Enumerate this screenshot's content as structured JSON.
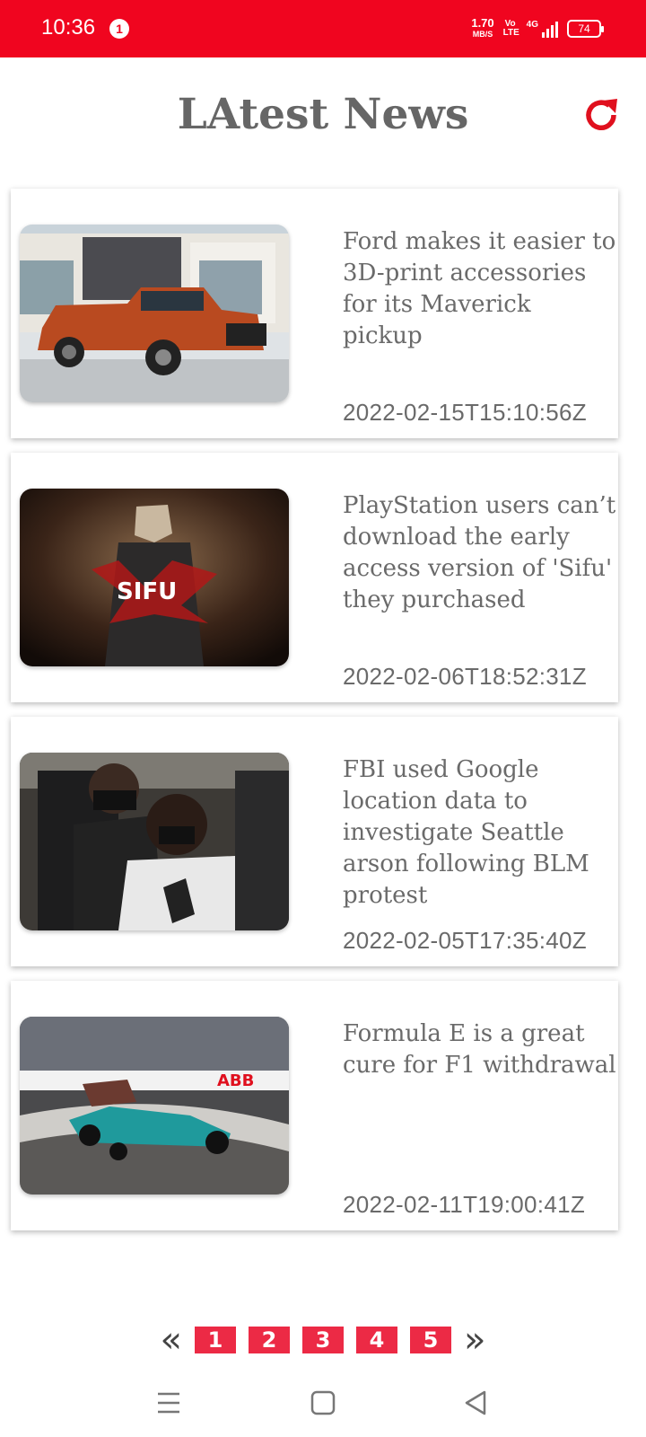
{
  "status_bar": {
    "time": "10:36",
    "notification_count": "1",
    "speed_value": "1.70",
    "speed_unit": "MB/S",
    "volte": "Vo LTE",
    "network": "4G",
    "battery": "74"
  },
  "header": {
    "title": "LAtest News",
    "refresh_icon": "refresh-icon"
  },
  "articles": [
    {
      "headline": "Ford makes it easier to 3D-print accessories for its Maverick pickup",
      "timestamp": "2022-02-15T15:10:56Z",
      "image": "orange pickup truck"
    },
    {
      "headline": "PlayStation users can’t download the early access version of 'Sifu' they purchased",
      "timestamp": "2022-02-06T18:52:31Z",
      "image": "Sifu game art",
      "image_text": "SIFU"
    },
    {
      "headline": "FBI used Google location data to investigate Seattle arson following BLM protest",
      "timestamp": "2022-02-05T17:35:40Z",
      "image": "protesters with masks"
    },
    {
      "headline": "Formula E is a great cure for F1 withdrawal",
      "timestamp": "2022-02-11T19:00:41Z",
      "image": "formula e race car",
      "image_text": "ABB"
    }
  ],
  "pagination": {
    "prev": "«",
    "next": "»",
    "pages": [
      "1",
      "2",
      "3",
      "4",
      "5"
    ]
  },
  "colors": {
    "accent": "#f0051f",
    "page_button": "#ec2a45",
    "text": "#6a6a6a"
  }
}
